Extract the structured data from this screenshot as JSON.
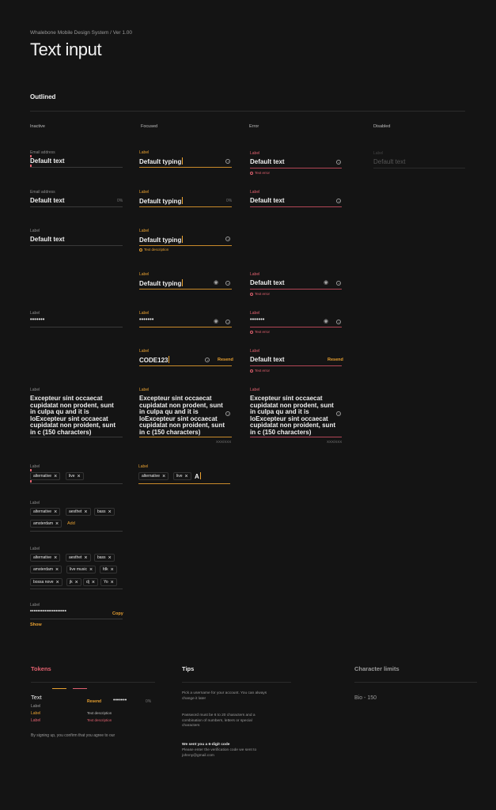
{
  "header": {
    "breadcrumb": "Whalebone Mobile Design System / Ver 1.00",
    "title": "Text input"
  },
  "section": "Outlined",
  "columns": [
    "Inactive",
    "Focused",
    "Error",
    "Disabled"
  ],
  "rows": {
    "r1": {
      "inactive": {
        "label": "Email address",
        "value": "Default text"
      },
      "focused": {
        "label": "Label",
        "value": "Default typing"
      },
      "error": {
        "label": "Label",
        "value": "Default text",
        "help": "Text error"
      },
      "disabled": {
        "label": "Label",
        "value": "Default text"
      }
    },
    "r2": {
      "inactive": {
        "label": "Email address",
        "value": "Default text",
        "suffix": "0%"
      },
      "focused": {
        "label": "Label",
        "value": "Default typing",
        "suffix": "0%"
      },
      "error": {
        "label": "Label",
        "value": "Default text"
      }
    },
    "r3": {
      "inactive": {
        "label": "Label",
        "value": "Default text"
      },
      "focused": {
        "label": "Label",
        "value": "Default typing",
        "help": "Text description"
      }
    },
    "r4": {
      "focused": {
        "label": "Label",
        "value": "Default typing"
      },
      "error": {
        "label": "Label",
        "value": "Default text",
        "help": "Text error"
      }
    },
    "r5": {
      "inactive": {
        "label": "Label",
        "value": "•••••••"
      },
      "focused": {
        "label": "Label",
        "value": "•••••••"
      },
      "error": {
        "label": "Label",
        "value": "•••••••",
        "help": "Text error"
      }
    },
    "r6": {
      "focused": {
        "label": "Label",
        "value": "CODE123",
        "action": "Resend"
      },
      "error": {
        "label": "Label",
        "value": "Default text",
        "action": "Resend",
        "help": "Text error"
      }
    },
    "r7": {
      "text": "Excepteur sint occaecat cupidatat non prodent, sunt in culpa qu and it is loExcepteur sint occaecat cupidatat non proident, sunt in c (150 characters)",
      "label": "Label",
      "counter": "XXX/XXX"
    },
    "r8": {
      "label": "Label",
      "chips": [
        "alternative",
        "live"
      ],
      "typing": "A"
    },
    "r9": {
      "label": "Label",
      "chips": [
        "alternative",
        "aesthet",
        "bass",
        "amsterdam"
      ],
      "add": "Add"
    },
    "r10": {
      "label": "Label",
      "chips": [
        "alternative",
        "aesthet",
        "bass",
        "amsterdam",
        "live music",
        "fdk",
        "bossa nove",
        "jk",
        "dj",
        "Yo"
      ]
    },
    "r11": {
      "label": "Label",
      "value": "••••••••••••••••••••",
      "copy": "Copy",
      "show": "Show"
    }
  },
  "tokens": {
    "title": "Tokens",
    "text": "Text",
    "label1": "Label",
    "label2": "Label",
    "label3": "Label",
    "resend": "Resend",
    "dots": "•••••••",
    "pct": "0%",
    "desc1": "Text description",
    "desc2": "Text description",
    "terms": "By signing up, you confirm that you agree to our"
  },
  "tips": {
    "title": "Tips",
    "t1": "Pick a username for your account. You can always change it later",
    "t2": "Password must be 6 to 20 characters and a combination of numbers, letters or special characters",
    "t3_title": "We sent you a 6-digit code",
    "t3": "Please enter the verification code we sent to johnny@gmail.com"
  },
  "limits": {
    "title": "Character limits",
    "bio": "Bio - 150"
  },
  "colors": {
    "background": "#141414",
    "accent": "#e8a030",
    "error": "#e0606e",
    "tokens_title": "#e0606e"
  }
}
